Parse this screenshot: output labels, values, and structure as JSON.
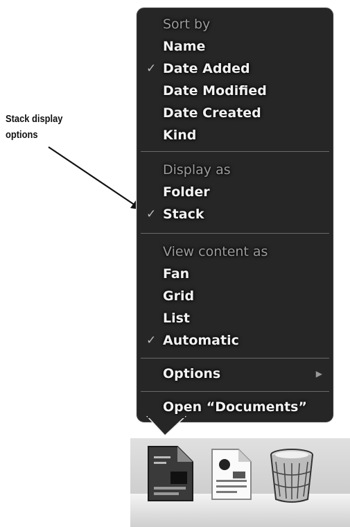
{
  "annotation": {
    "text": "Stack display options"
  },
  "menu": {
    "sort_header": "Sort by",
    "sort_items": [
      {
        "label": "Name",
        "checked": false
      },
      {
        "label": "Date Added",
        "checked": true
      },
      {
        "label": "Date Modified",
        "checked": false
      },
      {
        "label": "Date Created",
        "checked": false
      },
      {
        "label": "Kind",
        "checked": false
      }
    ],
    "display_header": "Display as",
    "display_items": [
      {
        "label": "Folder",
        "checked": false
      },
      {
        "label": "Stack",
        "checked": true
      }
    ],
    "view_header": "View content as",
    "view_items": [
      {
        "label": "Fan",
        "checked": false
      },
      {
        "label": "Grid",
        "checked": false
      },
      {
        "label": "List",
        "checked": false
      },
      {
        "label": "Automatic",
        "checked": true
      }
    ],
    "options_label": "Options",
    "open_label": "Open “Documents”",
    "check_glyph": "✓",
    "submenu_glyph": "▶"
  },
  "dock": {
    "icons": [
      "documents-stack-icon",
      "document-file-icon",
      "trash-icon"
    ]
  },
  "colors": {
    "menu_bg": "#262626",
    "header_text": "#9b9b9b",
    "item_text": "#f2f2f2"
  }
}
